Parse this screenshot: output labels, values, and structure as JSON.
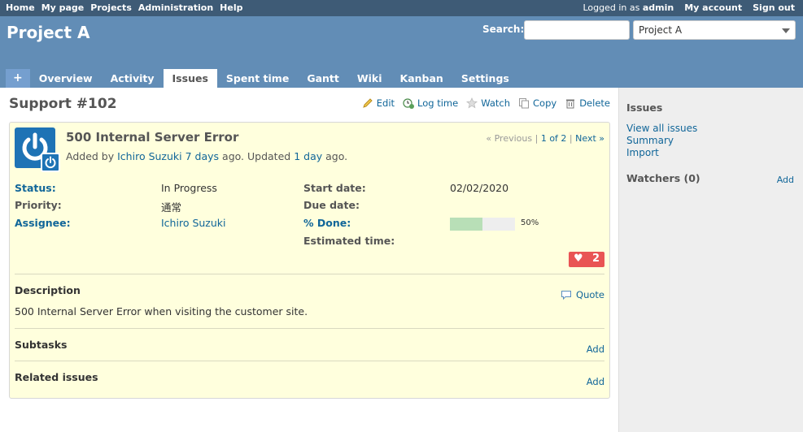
{
  "top_menu": {
    "left": [
      "Home",
      "My page",
      "Projects",
      "Administration",
      "Help"
    ],
    "logged_in_prefix": "Logged in as",
    "logged_in_user": "admin",
    "my_account": "My account",
    "sign_out": "Sign out"
  },
  "header": {
    "project_title": "Project A",
    "search_label": "Search:",
    "search_value": "",
    "project_select": "Project A"
  },
  "tabs": {
    "new": "+",
    "overview": "Overview",
    "activity": "Activity",
    "issues": "Issues",
    "spent_time": "Spent time",
    "gantt": "Gantt",
    "wiki": "Wiki",
    "kanban": "Kanban",
    "settings": "Settings",
    "selected": "Issues"
  },
  "issue": {
    "heading": "Support #102",
    "actions": {
      "edit": "Edit",
      "log_time": "Log time",
      "watch": "Watch",
      "copy": "Copy",
      "delete": "Delete"
    },
    "subject": "500 Internal Server Error",
    "added_by_prefix": "Added by",
    "author": "Ichiro Suzuki",
    "added_ago": "7 days",
    "updated_text": "ago. Updated",
    "updated_ago": "1 day",
    "ago_suffix": "ago.",
    "prev": "« Previous",
    "sep1": "|",
    "position": "1 of 2",
    "sep2": "|",
    "next": "Next »",
    "status_label": "Status:",
    "status_value": "In Progress",
    "priority_label": "Priority:",
    "priority_value": "通常",
    "assignee_label": "Assignee:",
    "assignee_value": "Ichiro Suzuki",
    "start_date_label": "Start date:",
    "start_date_value": "02/02/2020",
    "due_date_label": "Due date:",
    "due_date_value": "",
    "done_label": "% Done:",
    "done_percent": 50,
    "done_text": "50%",
    "estimated_label": "Estimated time:",
    "estimated_value": "",
    "like_count": "2",
    "description_title": "Description",
    "quote": "Quote",
    "description_text": "500 Internal Server Error when visiting the customer site.",
    "subtasks_title": "Subtasks",
    "subtasks_add": "Add",
    "related_title": "Related issues",
    "related_add": "Add"
  },
  "sidebar": {
    "issues_title": "Issues",
    "view_all": "View all issues",
    "summary": "Summary",
    "import": "Import",
    "watchers_title": "Watchers (0)",
    "watchers_add": "Add"
  },
  "colors": {
    "top_menu_bg": "#3e5b76",
    "header_bg": "#628db6",
    "issue_bg": "#ffffdd",
    "link": "#116699",
    "progress_done": "#b8dfb7",
    "like_bg": "#e95454"
  }
}
